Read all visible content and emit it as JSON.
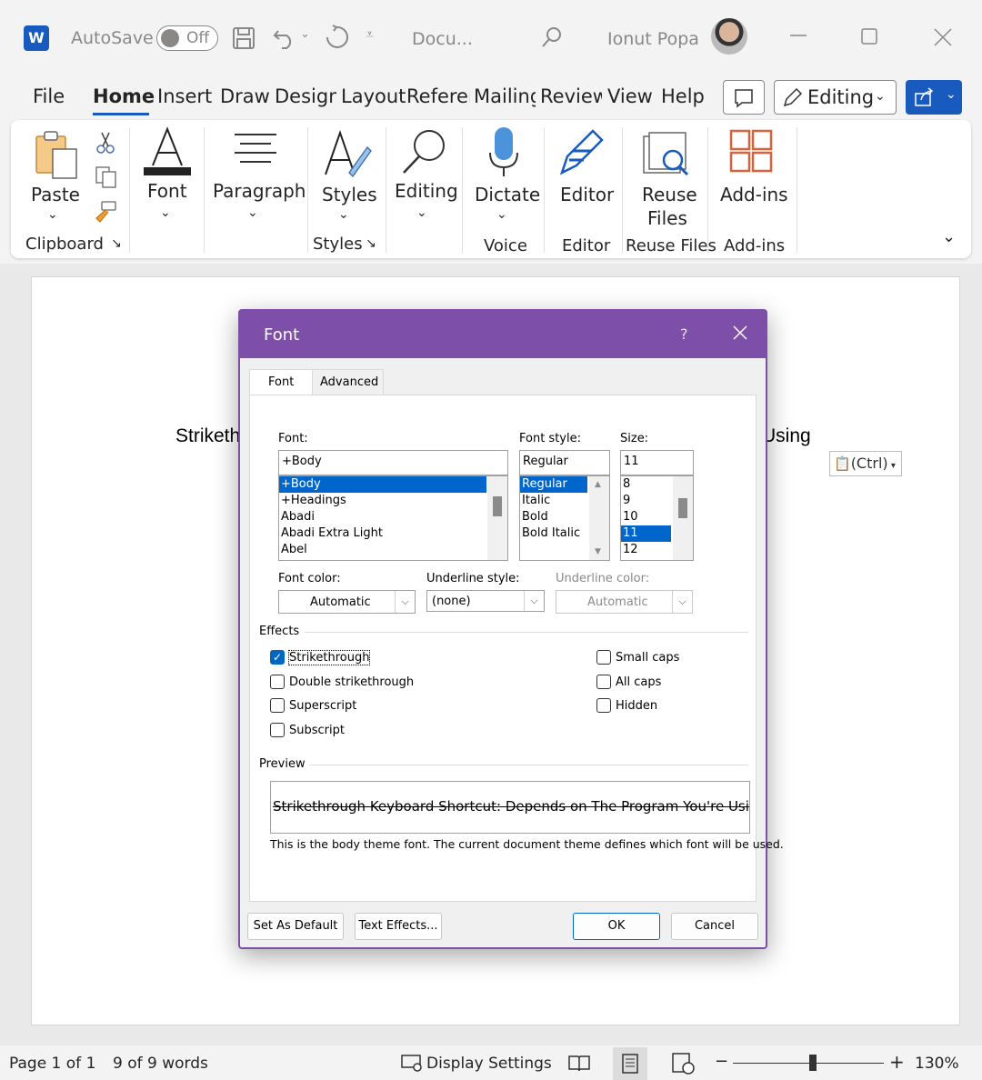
{
  "titlebar": {
    "autosave_label": "AutoSave",
    "autosave_state": "Off",
    "doc_name": "Docu...",
    "user_name": "Ionut Popa",
    "app_logo": "W"
  },
  "menu": {
    "tabs": [
      "File",
      "Home",
      "Insert",
      "Draw",
      "Design",
      "Layout",
      "Referen",
      "Mailing",
      "Review",
      "View",
      "Help"
    ],
    "editing_label": "Editing"
  },
  "ribbon": {
    "paste": "Paste",
    "font": "Font",
    "paragraph": "Paragraph",
    "styles": "Styles",
    "editing": "Editing",
    "dictate": "Dictate",
    "editor": "Editor",
    "reuse_files_1": "Reuse",
    "reuse_files_2": "Files",
    "addins": "Add-ins",
    "groups": {
      "clipboard": "Clipboard",
      "styles": "Styles",
      "voice": "Voice",
      "editor": "Editor",
      "reuse_files": "Reuse Files",
      "addins": "Add-ins"
    }
  },
  "document": {
    "text_left": "Striketh",
    "text_right": "Using",
    "paste_options": "(Ctrl)"
  },
  "dialog": {
    "title": "Font",
    "help": "?",
    "tabs": {
      "font": "Font",
      "advanced": "Advanced"
    },
    "font_label": "Font:",
    "font_value": "+Body",
    "font_list": [
      "+Body",
      "+Headings",
      "Abadi",
      "Abadi Extra Light",
      "Abel"
    ],
    "style_label": "Font style:",
    "style_value": "Regular",
    "style_list": [
      "Regular",
      "Italic",
      "Bold",
      "Bold Italic"
    ],
    "size_label": "Size:",
    "size_value": "11",
    "size_list": [
      "8",
      "9",
      "10",
      "11",
      "12"
    ],
    "font_color_label": "Font color:",
    "font_color_value": "Automatic",
    "underline_style_label": "Underline style:",
    "underline_style_value": "(none)",
    "underline_color_label": "Underline color:",
    "underline_color_value": "Automatic",
    "effects_label": "Effects",
    "effects": {
      "strikethrough": "Strikethrough",
      "double_strikethrough": "Double strikethrough",
      "superscript": "Superscript",
      "subscript": "Subscript",
      "small_caps": "Small caps",
      "all_caps": "All caps",
      "hidden": "Hidden"
    },
    "preview_label": "Preview",
    "preview_text": "Strikethrough Keyboard Shortcut: Depends on The Program You're Using",
    "preview_note": "This is the body theme font. The current document theme defines which font will be used.",
    "buttons": {
      "set_default": "Set As Default",
      "text_effects": "Text Effects...",
      "ok": "OK",
      "cancel": "Cancel"
    }
  },
  "statusbar": {
    "page": "Page 1 of 1",
    "words": "9 of 9 words",
    "display_settings": "Display Settings",
    "zoom": "130%"
  }
}
